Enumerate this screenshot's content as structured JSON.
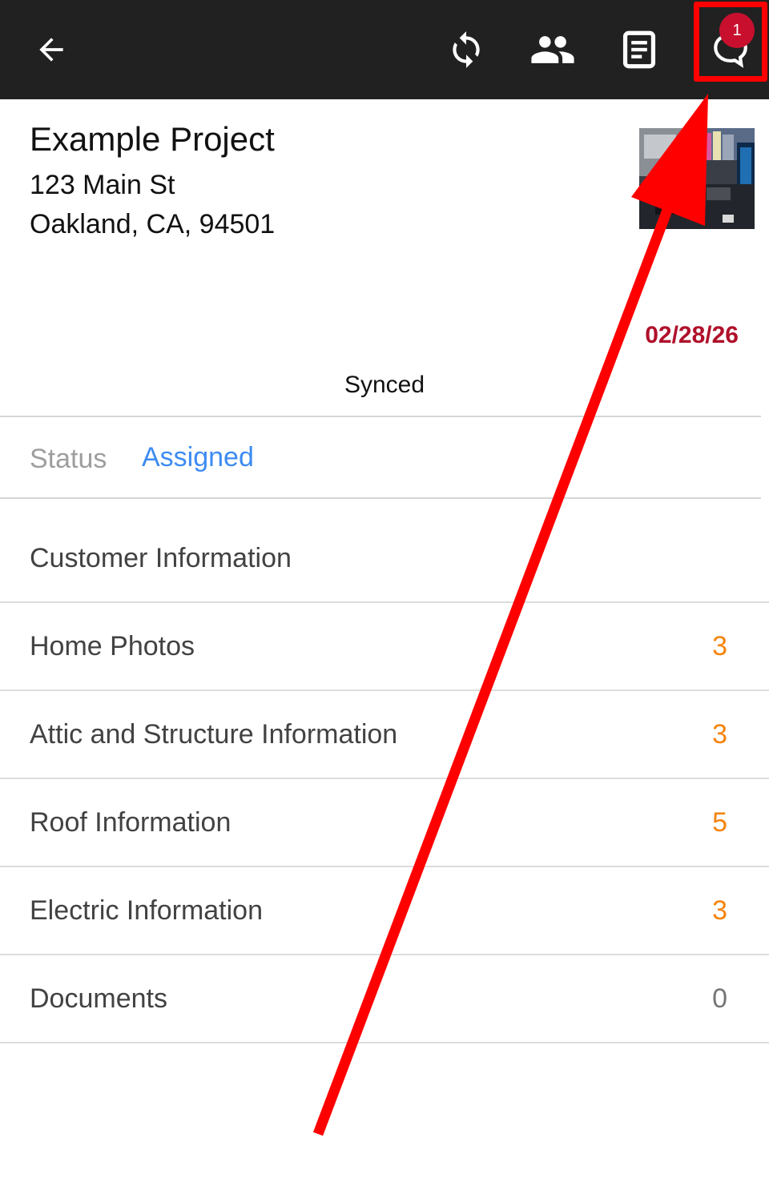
{
  "toolbar": {
    "back_icon": "arrow-left-icon",
    "sync_icon": "sync-icon",
    "people_icon": "people-icon",
    "document_icon": "document-icon",
    "chat_icon": "chat-bubble-icon",
    "chat_badge": "1",
    "background": "#212121"
  },
  "project": {
    "name": "Example Project",
    "address_line1": "123 Main St",
    "address_line2": "Oakland, CA, 94501",
    "due_date": "02/28/26",
    "sync_status": "Synced"
  },
  "status": {
    "label": "Status",
    "value": "Assigned"
  },
  "sections": [
    {
      "label": "Customer Information",
      "count": ""
    },
    {
      "label": "Home Photos",
      "count": "3"
    },
    {
      "label": "Attic and Structure Information",
      "count": "3"
    },
    {
      "label": "Roof Information",
      "count": "5"
    },
    {
      "label": "Electric Information",
      "count": "3"
    },
    {
      "label": "Documents",
      "count": "0"
    }
  ],
  "colors": {
    "count_highlight": "#f5840c",
    "count_zero": "#757575",
    "status_value": "#3d8bf2",
    "due_date": "#b0102a",
    "annotation": "#ff0000"
  }
}
